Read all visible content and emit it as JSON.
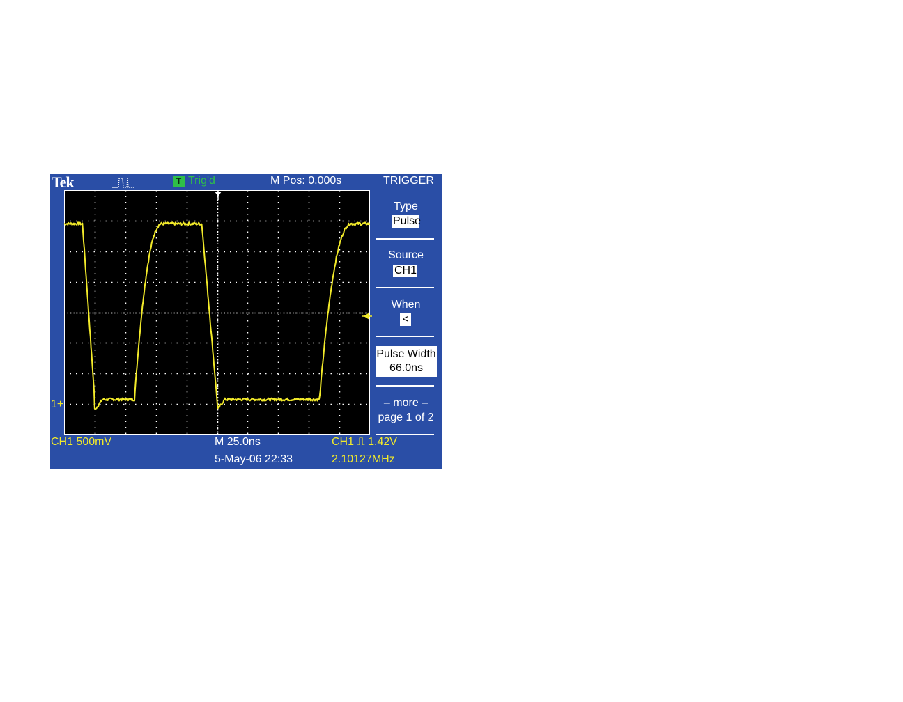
{
  "header": {
    "brand": "Tek",
    "trigger_type_icon": "pulse-trigger-icon",
    "status_badge": "T",
    "status": "Trig'd",
    "main_position": "M Pos: 0.000s"
  },
  "menu": {
    "title": "TRIGGER",
    "items": [
      {
        "label": "Type",
        "value": "Pulse"
      },
      {
        "label": "Source",
        "value": "CH1"
      },
      {
        "label": "When",
        "value": "<"
      },
      {
        "label": "Pulse Width",
        "value": "66.0ns"
      },
      {
        "label": "– more –",
        "value": "page 1 of 2"
      }
    ]
  },
  "waveform": {
    "channel_marker": "1+",
    "divisions": {
      "horizontal": 10,
      "vertical": 8
    },
    "trace_color": "#f2ea2a",
    "high_level_div": 6.9,
    "low_level_div": 1.15,
    "edges_div": [
      {
        "type": "falling",
        "start": 0.6,
        "end": 1.0
      },
      {
        "type": "rising",
        "start": 2.3,
        "end": 3.2
      },
      {
        "type": "falling",
        "start": 4.5,
        "end": 5.0
      },
      {
        "type": "rising",
        "start": 8.35,
        "end": 9.4
      }
    ]
  },
  "footer": {
    "ch1_scale": "CH1  500mV",
    "timebase": "M 25.0ns",
    "datetime": "5-May-06 22:33",
    "trigger_readout": "CH1 ⎍ 1.42V",
    "frequency": "2.10127MHz"
  },
  "colors": {
    "frame": "#2a4ea6",
    "screen": "#000000",
    "trace": "#f2ea2a",
    "status": "#2fbf49"
  }
}
